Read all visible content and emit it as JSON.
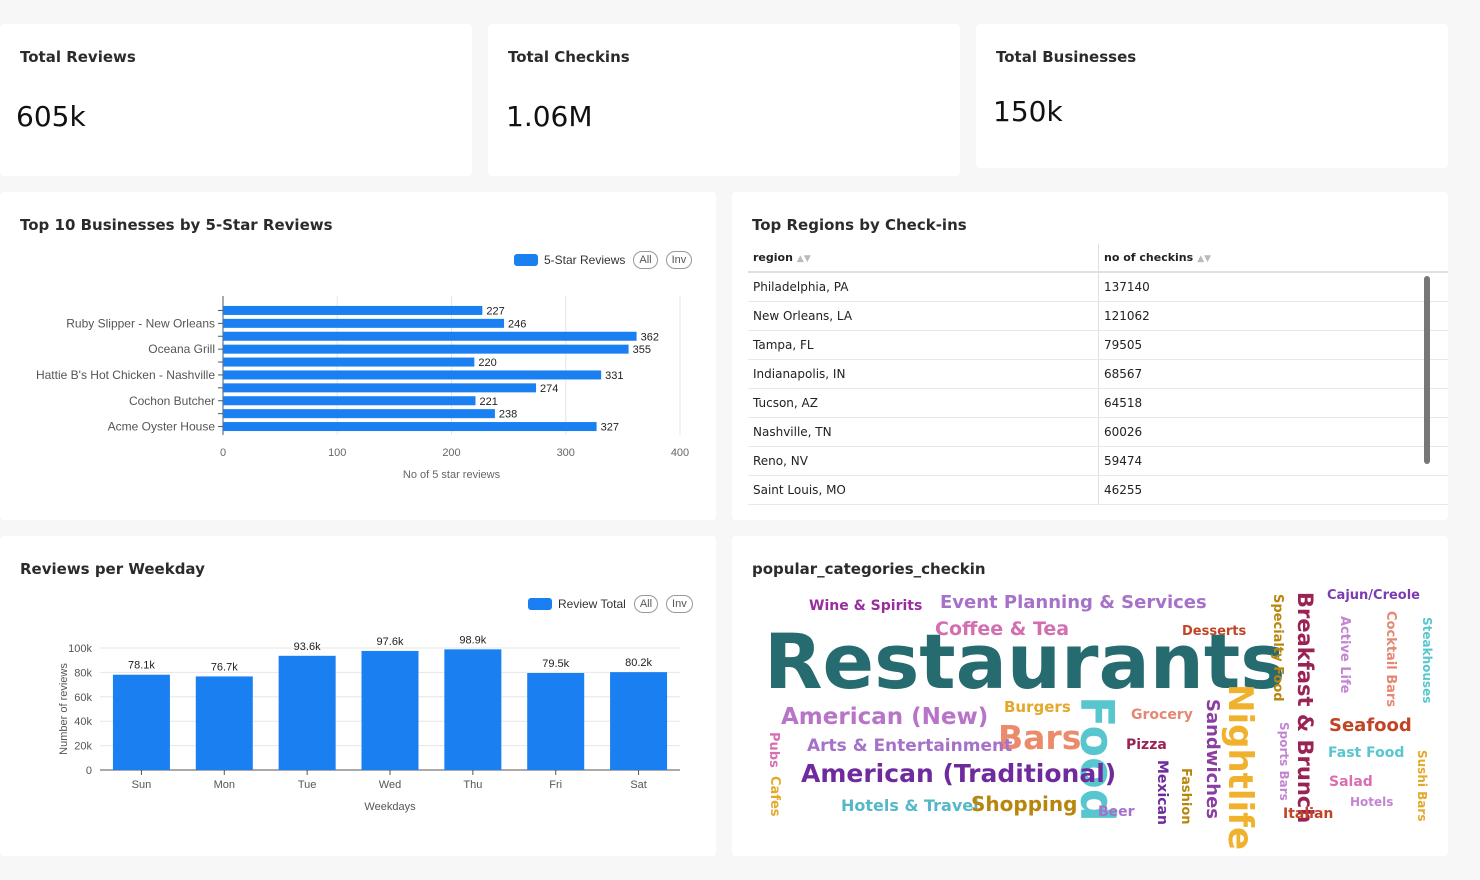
{
  "kpis": {
    "reviews": {
      "label": "Total Reviews",
      "value": "605k"
    },
    "checkins": {
      "label": "Total Checkins",
      "value": "1.06M"
    },
    "businesses": {
      "label": "Total Businesses",
      "value": "150k"
    }
  },
  "controls": {
    "all": "All",
    "inv": "Inv"
  },
  "top_businesses": {
    "title": "Top 10 Businesses by 5-Star Reviews",
    "legend": "5-Star Reviews",
    "xlabel": "No of 5 star reviews",
    "ticks": [
      "0",
      "100",
      "200",
      "300",
      "400"
    ]
  },
  "regions": {
    "title": "Top Regions by Check-ins",
    "columns": [
      "region",
      "no of checkins"
    ],
    "rows": [
      [
        "Philadelphia, PA",
        "137140"
      ],
      [
        "New Orleans, LA",
        "121062"
      ],
      [
        "Tampa, FL",
        "79505"
      ],
      [
        "Indianapolis, IN",
        "68567"
      ],
      [
        "Tucson, AZ",
        "64518"
      ],
      [
        "Nashville, TN",
        "60026"
      ],
      [
        "Reno, NV",
        "59474"
      ],
      [
        "Saint Louis, MO",
        "46255"
      ]
    ]
  },
  "weekday": {
    "title": "Reviews per Weekday",
    "legend": "Review Total",
    "xlabel": "Weekdays",
    "ylabel": "Number of reviews",
    "yticks": [
      "0",
      "20k",
      "40k",
      "60k",
      "80k",
      "100k"
    ]
  },
  "wordcloud": {
    "title": "popular_categories_checkin",
    "words": [
      {
        "text": "Restaurants",
        "color": "#266b6f"
      },
      {
        "text": "Event Planning & Services",
        "color": "#a672c9"
      },
      {
        "text": "Coffee & Tea",
        "color": "#d16fb1"
      },
      {
        "text": "Wine & Spirits",
        "color": "#9a2ca0"
      },
      {
        "text": "Desserts",
        "color": "#c24425"
      },
      {
        "text": "American (New)",
        "color": "#b774c9"
      },
      {
        "text": "Burgers",
        "color": "#e2a92a"
      },
      {
        "text": "Grocery",
        "color": "#e48873"
      },
      {
        "text": "Bars",
        "color": "#ec8a6c"
      },
      {
        "text": "Food",
        "color": "#58c6cf"
      },
      {
        "text": "Arts & Entertainment",
        "color": "#a672c9"
      },
      {
        "text": "Pizza",
        "color": "#9a2355"
      },
      {
        "text": "American (Traditional)",
        "color": "#6f2b9e"
      },
      {
        "text": "Hotels & Travel",
        "color": "#55b8c9"
      },
      {
        "text": "Shopping",
        "color": "#b9860c"
      },
      {
        "text": "Beer",
        "color": "#a672c9"
      },
      {
        "text": "Pubs",
        "color": "#d86fb1"
      },
      {
        "text": "Cafes",
        "color": "#e2a92a"
      },
      {
        "text": "Sandwiches",
        "color": "#8b3ea2"
      },
      {
        "text": "Mexican",
        "color": "#6f2b9e"
      },
      {
        "text": "Fashion",
        "color": "#b9860c"
      },
      {
        "text": "Nightlife",
        "color": "#f0b12d"
      },
      {
        "text": "Specialty Food",
        "color": "#b9860c"
      },
      {
        "text": "Breakfast & Brunch",
        "color": "#9a2355"
      },
      {
        "text": "Sports Bars",
        "color": "#c285d1"
      },
      {
        "text": "Italian",
        "color": "#c24425"
      },
      {
        "text": "Cajun/Creole",
        "color": "#7a3cb0"
      },
      {
        "text": "Active Life",
        "color": "#c285d1"
      },
      {
        "text": "Cocktail Bars",
        "color": "#e48873"
      },
      {
        "text": "Steakhouses",
        "color": "#58c6cf"
      },
      {
        "text": "Seafood",
        "color": "#c24425"
      },
      {
        "text": "Fast Food",
        "color": "#58c6cf"
      },
      {
        "text": "Salad",
        "color": "#d86fb1"
      },
      {
        "text": "Hotels",
        "color": "#c285d1"
      },
      {
        "text": "Sushi Bars",
        "color": "#e2a92a"
      }
    ]
  },
  "chart_data": [
    {
      "type": "bar",
      "orientation": "horizontal",
      "title": "Top 10 Businesses by 5-Star Reviews",
      "xlabel": "No of 5 star reviews",
      "ylabel": "",
      "xlim": [
        0,
        400
      ],
      "categories": [
        "",
        "Ruby Slipper - New Orleans",
        "",
        "Oceana Grill",
        "",
        "Hattie B's Hot Chicken - Nashville",
        "",
        "Cochon Butcher",
        "",
        "Acme Oyster House"
      ],
      "series": [
        {
          "name": "5-Star Reviews",
          "values": [
            227,
            246,
            362,
            355,
            220,
            331,
            274,
            221,
            238,
            327
          ]
        }
      ],
      "color": "#1a7ff0",
      "grid": true,
      "legend": "top-right"
    },
    {
      "type": "bar",
      "title": "Reviews per Weekday",
      "xlabel": "Weekdays",
      "ylabel": "Number of reviews",
      "ylim": [
        0,
        100000
      ],
      "categories": [
        "Sun",
        "Mon",
        "Tue",
        "Wed",
        "Thu",
        "Fri",
        "Sat"
      ],
      "series": [
        {
          "name": "Review Total",
          "values": [
            78100,
            76700,
            93600,
            97600,
            98900,
            79500,
            80200
          ],
          "labels": [
            "78.1k",
            "76.7k",
            "93.6k",
            "97.6k",
            "98.9k",
            "79.5k",
            "80.2k"
          ]
        }
      ],
      "color": "#1a7ff0",
      "grid": true,
      "legend": "top-right"
    }
  ]
}
